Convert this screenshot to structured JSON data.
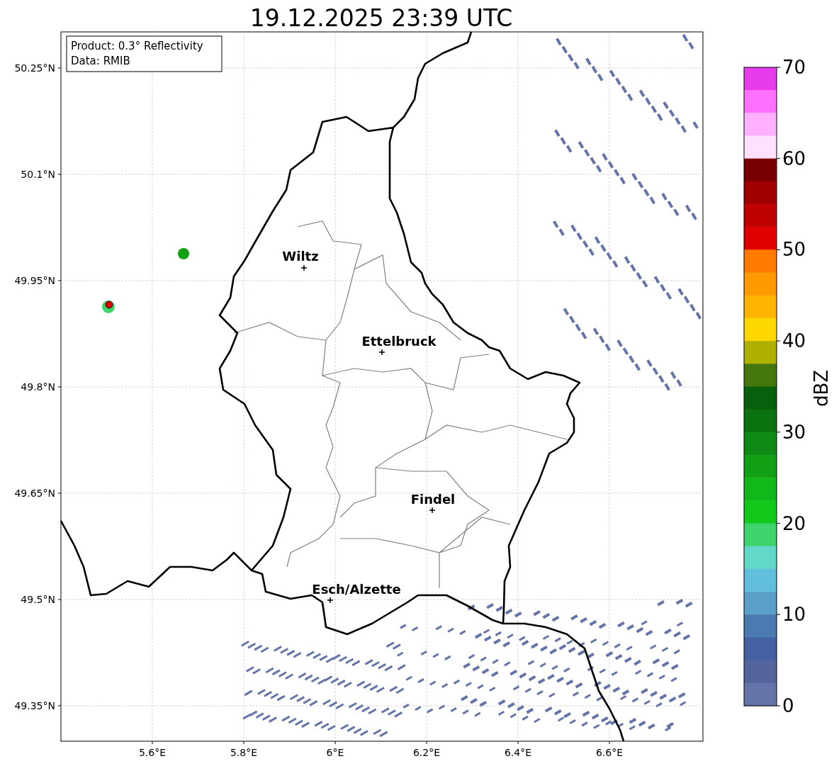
{
  "title": "19.12.2025 23:39 UTC",
  "legend": {
    "lines": [
      "Product: 0.3° Reflectivity",
      "Data: RMIB"
    ]
  },
  "map": {
    "xticks": [
      "5.6°E",
      "5.8°E",
      "6°E",
      "6.2°E",
      "6.4°E",
      "6.6°E"
    ],
    "yticks": [
      "50.25°N",
      "50.1°N",
      "49.95°N",
      "49.8°N",
      "49.65°N",
      "49.5°N",
      "49.35°N"
    ],
    "cities": [
      {
        "name": "Wiltz"
      },
      {
        "name": "Ettelbruck"
      },
      {
        "name": "Findel"
      },
      {
        "name": "Esch/Alzette"
      }
    ]
  },
  "colorbar": {
    "label": "dBZ",
    "ticks": [
      "70",
      "60",
      "50",
      "40",
      "30",
      "20",
      "10",
      "0"
    ],
    "bins": [
      {
        "color": "#e83cec"
      },
      {
        "color": "#ff70ff"
      },
      {
        "color": "#ffb0ff"
      },
      {
        "color": "#ffe0ff"
      },
      {
        "color": "#780000"
      },
      {
        "color": "#a00000"
      },
      {
        "color": "#c00000"
      },
      {
        "color": "#e00000"
      },
      {
        "color": "#ff7a00"
      },
      {
        "color": "#ff9a00"
      },
      {
        "color": "#ffb400"
      },
      {
        "color": "#ffd700"
      },
      {
        "color": "#b0b000"
      },
      {
        "color": "#44780c"
      },
      {
        "color": "#08600c"
      },
      {
        "color": "#0b7210"
      },
      {
        "color": "#0f8a14"
      },
      {
        "color": "#12a015"
      },
      {
        "color": "#12b81a"
      },
      {
        "color": "#12c81a"
      },
      {
        "color": "#3ed46c"
      },
      {
        "color": "#62d8c8"
      },
      {
        "color": "#62bfdc"
      },
      {
        "color": "#5a9fc8"
      },
      {
        "color": "#4a7ab0"
      },
      {
        "color": "#4560a3"
      },
      {
        "color": "#54659e"
      },
      {
        "color": "#6474a8"
      }
    ]
  }
}
